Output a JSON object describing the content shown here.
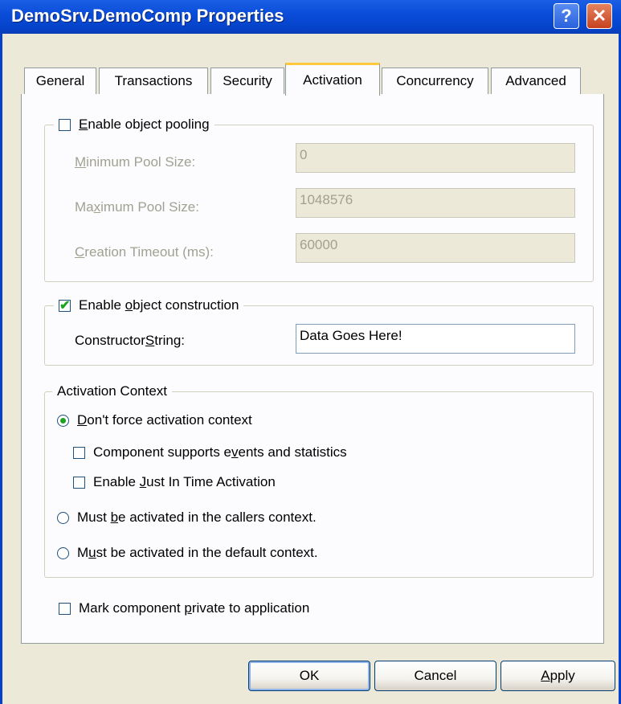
{
  "window": {
    "title": "DemoSrv.DemoComp Properties",
    "help_glyph": "?",
    "close_glyph": "✕"
  },
  "tabs": [
    {
      "label": "General"
    },
    {
      "label": "Transactions"
    },
    {
      "label": "Security"
    },
    {
      "label": "Activation"
    },
    {
      "label": "Concurrency"
    },
    {
      "label": "Advanced"
    }
  ],
  "active_tab": "Activation",
  "pooling": {
    "label_pre": "",
    "label_key": "E",
    "label_post": "nable object pooling",
    "checked": false,
    "min_label_key": "M",
    "min_label_post": "inimum Pool Size:",
    "min_value": "0",
    "max_label_pre": "Ma",
    "max_label_key": "x",
    "max_label_post": "imum Pool Size:",
    "max_value": "1048576",
    "timeout_label_key": "C",
    "timeout_label_post": "reation Timeout (ms):",
    "timeout_value": "60000"
  },
  "construction": {
    "label_pre": "Enable ",
    "label_key": "o",
    "label_post": "bject construction",
    "checked": true,
    "ctor_label_pre": "Constructor ",
    "ctor_label_key": "S",
    "ctor_label_post": "tring:",
    "ctor_value": "Data Goes Here!"
  },
  "context": {
    "legend": "Activation Context",
    "opt1_key": "D",
    "opt1_post": "on't force activation context",
    "events_pre": "Component supports e",
    "events_key": "v",
    "events_post": "ents and statistics",
    "jit_pre": "Enable ",
    "jit_key": "J",
    "jit_post": "ust In Time Activation",
    "opt2_pre": "Must ",
    "opt2_key": "b",
    "opt2_post": "e activated in the callers context.",
    "opt3_pre": "M",
    "opt3_key": "u",
    "opt3_post": "st be activated in the default context."
  },
  "private": {
    "pre": "Mark component ",
    "key": "p",
    "post": "rivate to application",
    "checked": false
  },
  "buttons": {
    "ok": "OK",
    "cancel": "Cancel",
    "apply_key": "A",
    "apply_post": "pply"
  }
}
